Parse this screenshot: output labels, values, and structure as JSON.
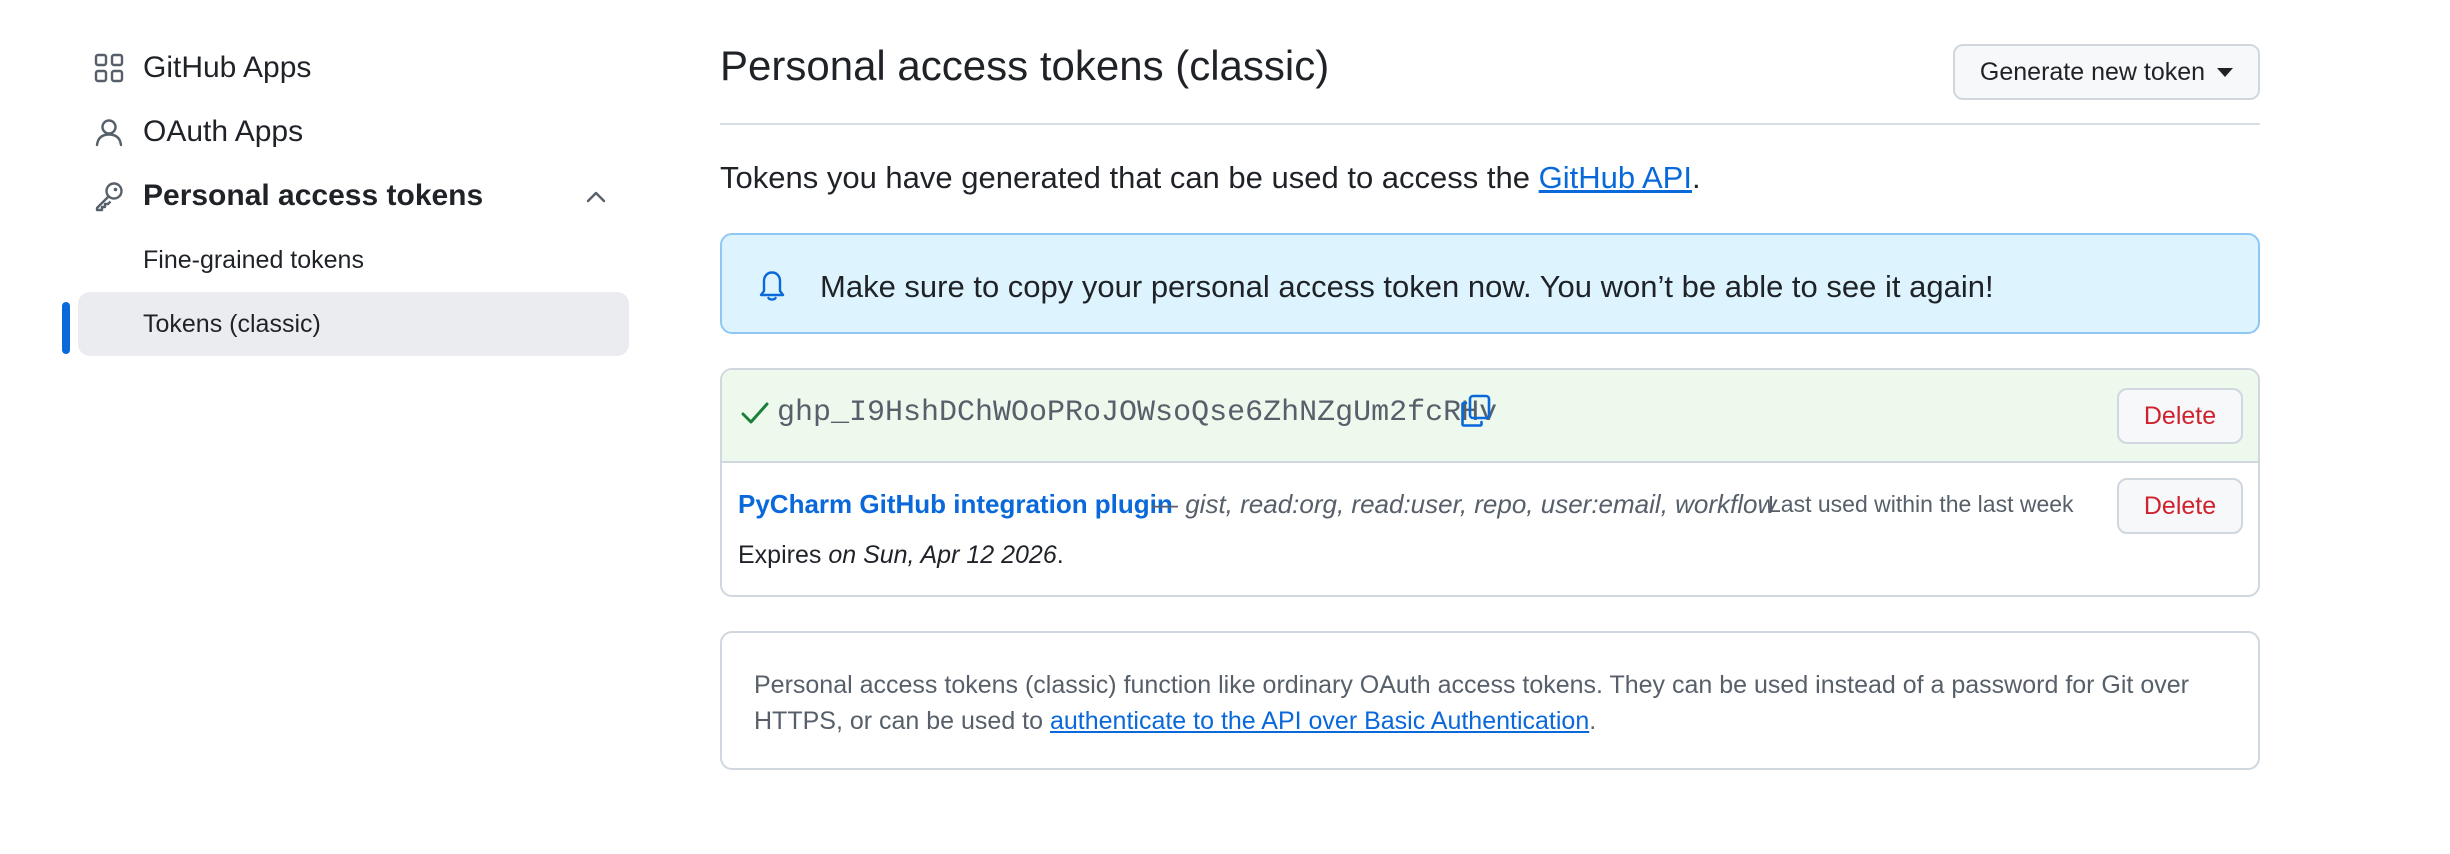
{
  "sidebar": {
    "items": [
      {
        "label": "GitHub Apps",
        "icon": "apps-grid-icon"
      },
      {
        "label": "OAuth Apps",
        "icon": "person-icon"
      },
      {
        "label": "Personal access tokens",
        "icon": "key-icon",
        "expanded": true,
        "children": [
          {
            "label": "Fine-grained tokens"
          },
          {
            "label": "Tokens (classic)",
            "active": true
          }
        ]
      }
    ]
  },
  "main": {
    "title": "Personal access tokens (classic)",
    "generate_button": "Generate new token",
    "intro_prefix": "Tokens you have generated that can be used to access the ",
    "intro_link": "GitHub API",
    "intro_suffix": ".",
    "flash_message": "Make sure to copy your personal access token now. You won’t be able to see it again!",
    "new_token": {
      "value": "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",
      "delete_label": "Delete"
    },
    "tokens": [
      {
        "name": "PyCharm GitHub integration plugin",
        "scopes": " — gist, read:org, read:user, repo, user:email, workflow",
        "last_used": "Last used within the last week",
        "expires_prefix": "Expires ",
        "expires_date": "on Sun, Apr 12 2026",
        "expires_suffix": ".",
        "delete_label": "Delete"
      }
    ],
    "info": {
      "text": "Personal access tokens (classic) function like ordinary OAuth access tokens. They can be used instead of a password for Git over HTTPS, or can be used to ",
      "link": "authenticate to the API over Basic Authentication",
      "suffix": "."
    }
  },
  "colors": {
    "accent": "#0969da",
    "danger": "#cf222e",
    "success": "#1a7f37",
    "flash_bg": "#ddf4ff"
  }
}
